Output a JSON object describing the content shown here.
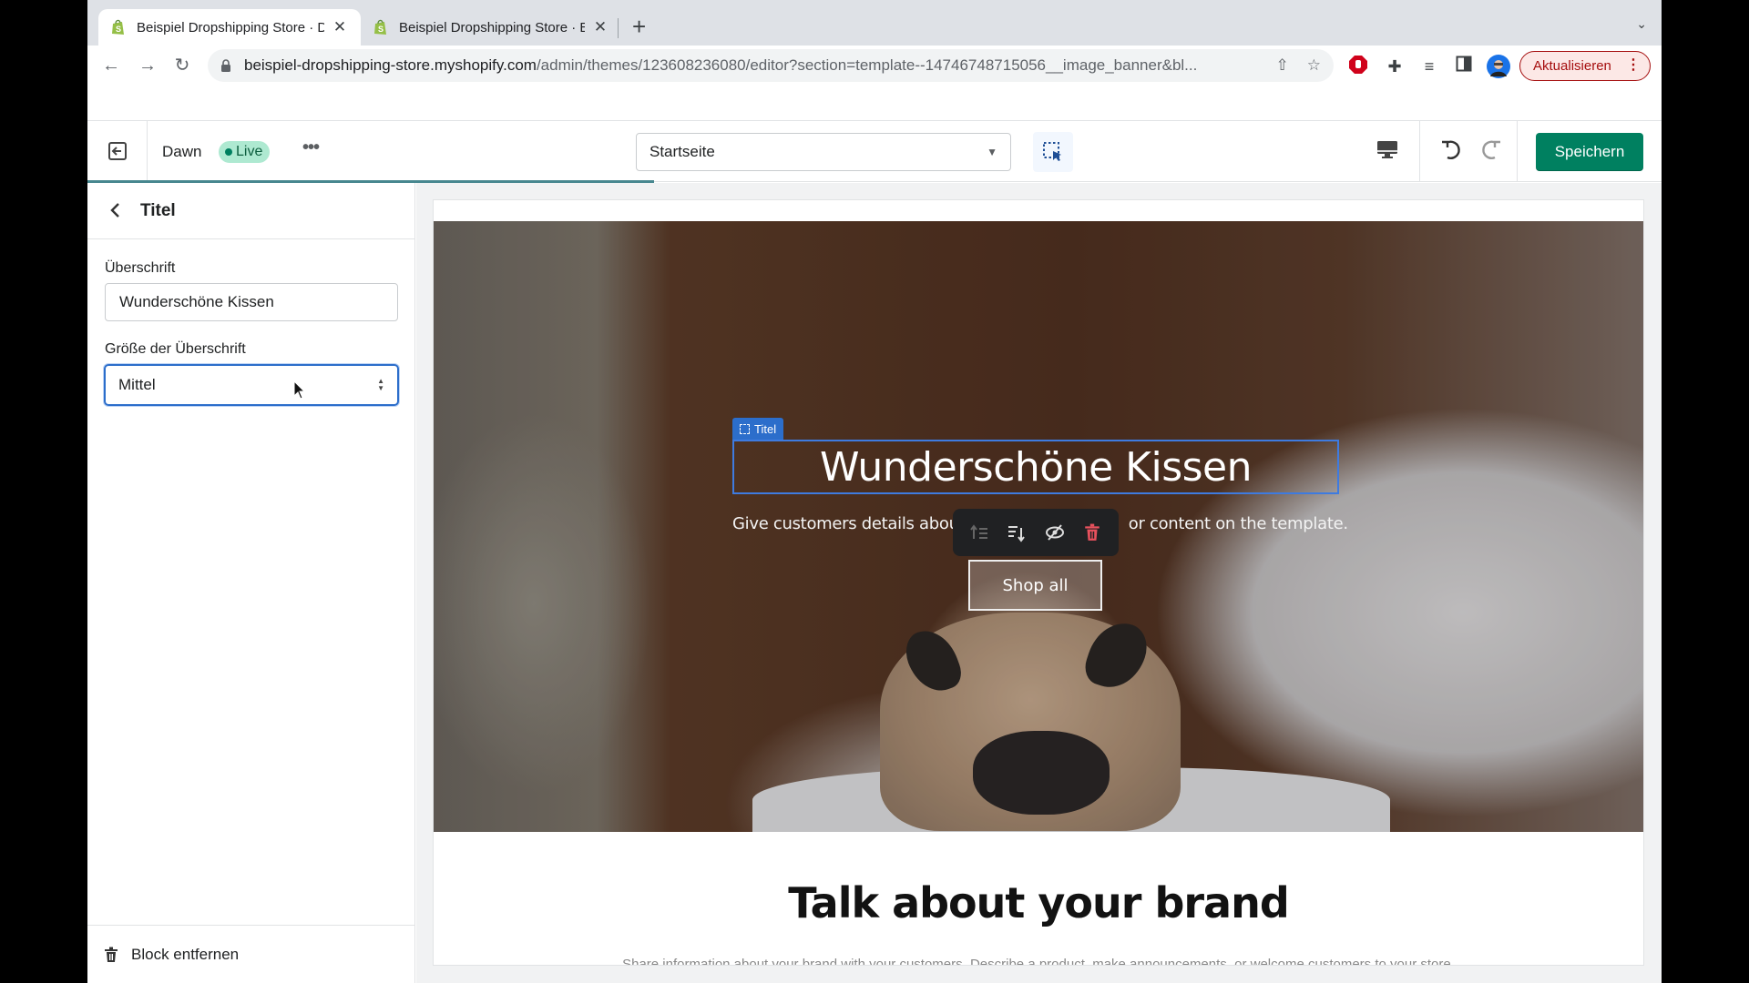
{
  "browser": {
    "tabs": [
      {
        "title": "Beispiel Dropshipping Store · D",
        "active": true,
        "icon": "shopify-icon"
      },
      {
        "title": "Beispiel Dropshipping Store · E",
        "active": false,
        "icon": "shopify-icon"
      }
    ],
    "new_tab": "+",
    "tab_search": "⌄",
    "url_host": "beispiel-dropshipping-store.myshopify.com",
    "url_path": "/admin/themes/123608236080/editor?section=template--14746748715056__image_banner&bl...",
    "update_button": "Aktualisieren",
    "nav": {
      "back": "←",
      "forward": "→",
      "reload": "↻"
    }
  },
  "editor": {
    "theme_name": "Dawn",
    "live_badge": "Live",
    "more": "•••",
    "page_select": "Startseite",
    "save_label": "Speichern",
    "progress": 0.36,
    "colors": {
      "accent": "#008060",
      "selection": "#2c6ecb",
      "live_bg": "#aee9d1"
    }
  },
  "sidebar": {
    "title": "Titel",
    "fields": [
      {
        "label": "Überschrift",
        "value": "Wunderschöne Kissen"
      },
      {
        "label": "Größe der Überschrift",
        "value": "Mittel"
      }
    ],
    "remove_block": "Block entfernen"
  },
  "preview": {
    "block_tag": "Titel",
    "hero_heading": "Wunderschöne Kissen",
    "hero_sub_left": "Give customers details abou",
    "hero_sub_right": "or content on the template.",
    "shop_button": "Shop all",
    "brand_heading": "Talk about your brand",
    "brand_text": "Share information about your brand with your customers. Describe a product, make announcements, or welcome customers to your store."
  }
}
